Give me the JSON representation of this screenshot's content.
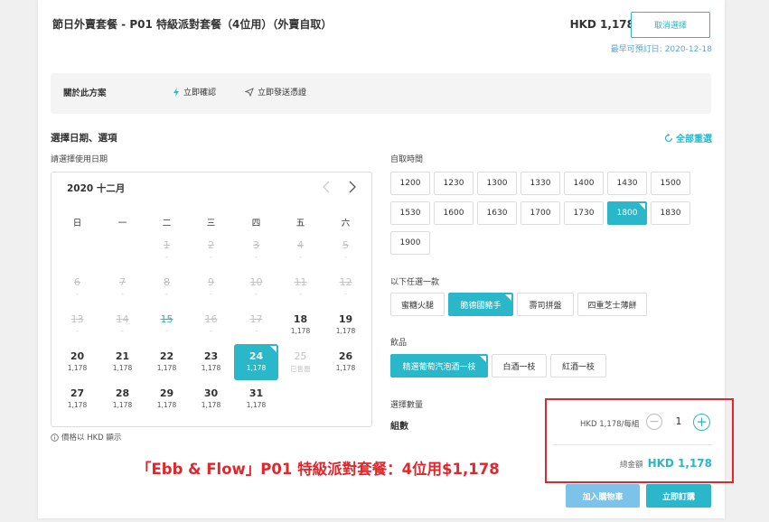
{
  "header": {
    "title": "節日外賣套餐 - P01 特級派對套餐（4位用）（外賣自取）",
    "price": "HKD 1,178",
    "cancel_label": "取消選擇",
    "earliest_date": "最早可預訂日: 2020-12-18"
  },
  "about": {
    "title": "關於此方案",
    "feature_instant": "立即確認",
    "feature_voucher": "立即發送憑證"
  },
  "section": {
    "title": "選擇日期、選項",
    "reset_label": "全部重選"
  },
  "calendar": {
    "label": "請選擇使用日期",
    "month": "2020 十二月",
    "weekdays": [
      "日",
      "一",
      "二",
      "三",
      "四",
      "五",
      "六"
    ],
    "days": [
      {
        "d": "1",
        "p": "-"
      },
      {
        "d": "2",
        "p": "-"
      },
      {
        "d": "3",
        "p": "-"
      },
      {
        "d": "4",
        "p": "-"
      },
      {
        "d": "5",
        "p": "-"
      },
      {
        "d": "6",
        "p": "-"
      },
      {
        "d": "7",
        "p": "-"
      },
      {
        "d": "8",
        "p": "-"
      },
      {
        "d": "9",
        "p": "-"
      },
      {
        "d": "10",
        "p": "-"
      },
      {
        "d": "11",
        "p": "-"
      },
      {
        "d": "12",
        "p": "-"
      },
      {
        "d": "13",
        "p": "-"
      },
      {
        "d": "14",
        "p": "-"
      },
      {
        "d": "15",
        "p": "-"
      },
      {
        "d": "16",
        "p": "-"
      },
      {
        "d": "17",
        "p": "-"
      },
      {
        "d": "18",
        "p": "1,178"
      },
      {
        "d": "19",
        "p": "1,178"
      },
      {
        "d": "20",
        "p": "1,178"
      },
      {
        "d": "21",
        "p": "1,178"
      },
      {
        "d": "22",
        "p": "1,178"
      },
      {
        "d": "23",
        "p": "1,178"
      },
      {
        "d": "24",
        "p": "1,178"
      },
      {
        "d": "25",
        "p": "已售罄"
      },
      {
        "d": "26",
        "p": "1,178"
      },
      {
        "d": "27",
        "p": "1,178"
      },
      {
        "d": "28",
        "p": "1,178"
      },
      {
        "d": "29",
        "p": "1,178"
      },
      {
        "d": "30",
        "p": "1,178"
      },
      {
        "d": "31",
        "p": "1,178"
      }
    ],
    "note": "價格以 HKD 顯示"
  },
  "pickup": {
    "label": "自取時間",
    "times": [
      "1200",
      "1230",
      "1300",
      "1330",
      "1400",
      "1430",
      "1500",
      "1530",
      "1600",
      "1630",
      "1700",
      "1730",
      "1800",
      "1830",
      "1900"
    ]
  },
  "choice": {
    "label": "以下任選一款",
    "options": [
      "蜜糖火腿",
      "脆德國豬手",
      "壽司拼盤",
      "四重芝士薄餅"
    ]
  },
  "drink": {
    "label": "飲品",
    "options": [
      "精選葡萄汽泡酒一枝",
      "白酒一枝",
      "紅酒一枝"
    ]
  },
  "quantity": {
    "label": "選擇數量",
    "name": "組數",
    "unit_price": "HKD 1,178/每組",
    "minus": "−",
    "value": "1",
    "plus": "+"
  },
  "total": {
    "label": "總金額",
    "value": "HKD 1,178"
  },
  "actions": {
    "cart_label": "加入購物車",
    "buy_label": "立即訂購"
  },
  "caption": "「Ebb & Flow」P01 特級派對套餐：4位用$1,178",
  "colors": {
    "accent": "#2ab7c9",
    "link": "#5aa6d6",
    "highlight": "#e3262b"
  }
}
